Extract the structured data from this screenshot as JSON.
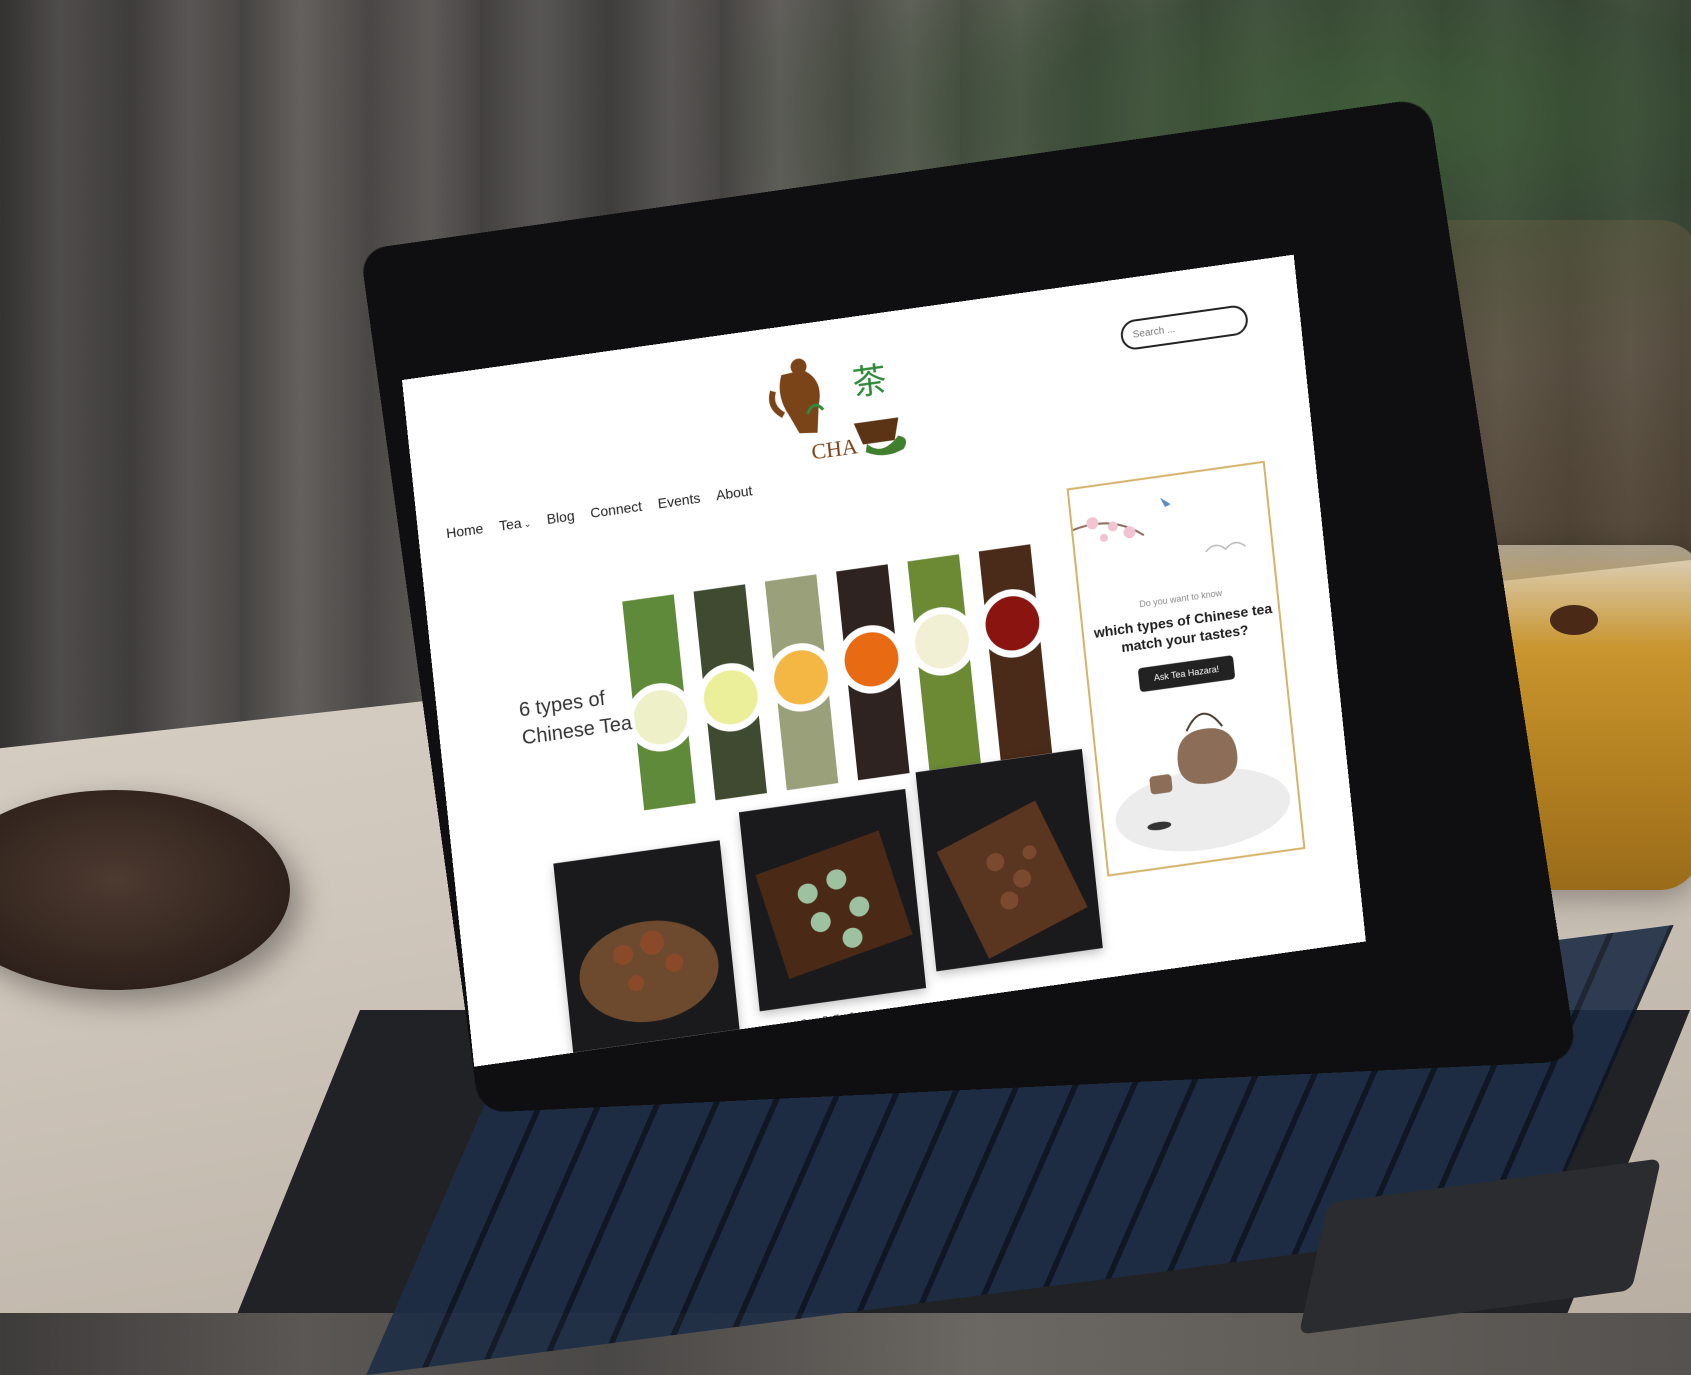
{
  "site": {
    "logo_glyph": "茶",
    "logo_text": "CHA"
  },
  "nav": {
    "items": [
      {
        "label": "Home"
      },
      {
        "label": "Tea",
        "has_dropdown": true
      },
      {
        "label": "Blog"
      },
      {
        "label": "Connect"
      },
      {
        "label": "Events"
      },
      {
        "label": "About"
      }
    ]
  },
  "search": {
    "placeholder": "Search ..."
  },
  "hero": {
    "title_line1": "6 types of",
    "title_line2": "Chinese Tea"
  },
  "gallery": {
    "caption": "Gong Fu Tea Sets"
  },
  "promo": {
    "small_text": "Do you want to know",
    "headline_line1": "which types of Chinese tea",
    "headline_line2": "match your tastes?",
    "button_label": "Ask Tea Hazara!"
  },
  "colors": {
    "accent_gold": "#d4b36a",
    "logo_green": "#2f8a3a",
    "logo_brown": "#7a4418"
  }
}
